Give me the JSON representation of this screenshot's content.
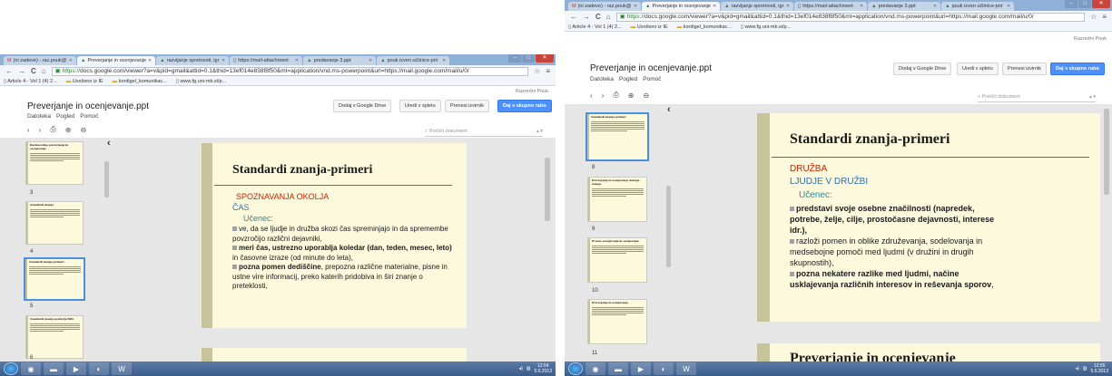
{
  "left": {
    "tabs": [
      {
        "icon": "gmail-icon",
        "label": "(ni zadeve) - raz.pouk@"
      },
      {
        "icon": "drive-icon",
        "label": "Preverjanje in ocenjevanje",
        "active": true
      },
      {
        "icon": "drive-icon",
        "label": "razvijanje spretnosti, igr"
      },
      {
        "icon": "page-icon",
        "label": "https://mail-attachment"
      },
      {
        "icon": "drive-icon",
        "label": "predavanje 3.ppt"
      },
      {
        "icon": "drive-icon",
        "label": "pouk izven učilnice-prir"
      }
    ],
    "url_secure": "https://",
    "url_rest": "docs.google.com/viewer?a=v&pid=gmail&attid=0.1&thid=13ef014e838f8f50&mt=application/vnd.ms-powerpoint&url=https://mail.google.com/mail/u/0/",
    "bookmarks": [
      "Article 4 - Vol 1 (4) 2...",
      "Uvoženo iz IE",
      "kordigel_komunikac...",
      "www.fg.uni-mb.si/p..."
    ],
    "owner": "Razredni Pouk",
    "thumbnails": [
      {
        "title": "Raziskovalno preverjanje in ocenjevanje",
        "num": "3"
      },
      {
        "title": "Standardi znanja",
        "num": "4"
      },
      {
        "title": "Standardi znanja-primeri",
        "num": "5"
      },
      {
        "title": "Standardi znanja-področja BRS",
        "num": "6"
      }
    ],
    "slide": {
      "title": "Standardi znanja-primeri",
      "subject": "SPOZNAVANJA OKOLJA",
      "topic": "ČAS",
      "pupil": "Učenec:",
      "b1": "ve, da se ljudje in družba skozi čas spreminjajo in da spremembe povzročijo različni dejavniki,",
      "b2_bold": "meri čas, ustrezno uporablja koledar (dan, teden, mesec, leto)",
      "b2_rest": " in časovne izraze (od minute do leta),",
      "b3_bold": "pozna pomen dediščine",
      "b3_rest": ", prepozna različne materialne, pisne in ustne vire informacij, preko katerih pridobiva in širi znanje o preteklosti,"
    },
    "clock": {
      "time": "12:54",
      "date": "5.6.2013"
    }
  },
  "right": {
    "tabs": [
      {
        "icon": "gmail-icon",
        "label": "(ni zadeve) - raz.pouk@"
      },
      {
        "icon": "drive-icon",
        "label": "Preverjanje in ocenjevanje",
        "active": true
      },
      {
        "icon": "drive-icon",
        "label": "razvijanje spretnosti, igr"
      },
      {
        "icon": "page-icon",
        "label": "https://mail-attachment"
      },
      {
        "icon": "drive-icon",
        "label": "predavanje 3.ppt"
      },
      {
        "icon": "drive-icon",
        "label": "pouk izven učilnice-prir"
      }
    ],
    "url_secure": "https://",
    "url_rest": "docs.google.com/viewer?a=v&pid=gmail&attid=0.1&thid=13ef014e838f8f50&mt=application/vnd.ms-powerpoint&url=https://mail.google.com/mail/u/0/",
    "bookmarks": [
      "Article 4 - Vol 1 (4) 2...",
      "Uvoženo iz IE",
      "kordigel_komunikac...",
      "www.fg.uni-mb.si/p..."
    ],
    "owner": "Razredni Pouk",
    "thumbnails": [
      {
        "title": "Standardi znanja-primeri",
        "num": "8"
      },
      {
        "title": "Preverjanje in ocenjevanje ustnega znanja",
        "num": "9"
      },
      {
        "title": "Pravno ocenjevanje in ocenjevanje",
        "num": "10"
      },
      {
        "title": "Preverjanje in ocenjevanje",
        "num": "11"
      }
    ],
    "slide": {
      "title": "Standardi znanja-primeri",
      "subject": "DRUŽBA",
      "topic": "LJUDJE V DRUŽBI",
      "pupil": "Učenec:",
      "b1_bold": "predstavi svoje osebne značilnosti (napredek, potrebe, želje, cilje, prostočasne dejavnosti, interese idr.),",
      "b2": "razloži pomen in oblike združevanja, sodelovanja in medsebojne pomoči med ljudmi (v družini in drugih skupnostih),",
      "b3_bold": "pozna nekatere razlike med ljudmi, načine usklajevanja različnih interesov in reševanja sporov",
      "b3_rest": ",",
      "next_title": "Preverjanje in ocenjevanje"
    },
    "clock": {
      "time": "12:55",
      "date": "5.6.2013"
    }
  },
  "doc": {
    "title": "Preverjanje in ocenjevanje.ppt",
    "menu_file": "Datoteka",
    "menu_view": "Pogled",
    "menu_help": "Pomoč",
    "btn_add": "Dodaj v Google Drive",
    "btn_edit": "Uredi v spletu",
    "btn_download": "Prenesi izvirnik",
    "btn_share": "Daj v skupno rabo",
    "search_placeholder": "Preišči dokument"
  },
  "colors": {
    "accent": "#4d90fe",
    "slide_bg": "#fcf9dc",
    "subject_red": "#cc2200",
    "topic_blue": "#2a6fb5"
  }
}
